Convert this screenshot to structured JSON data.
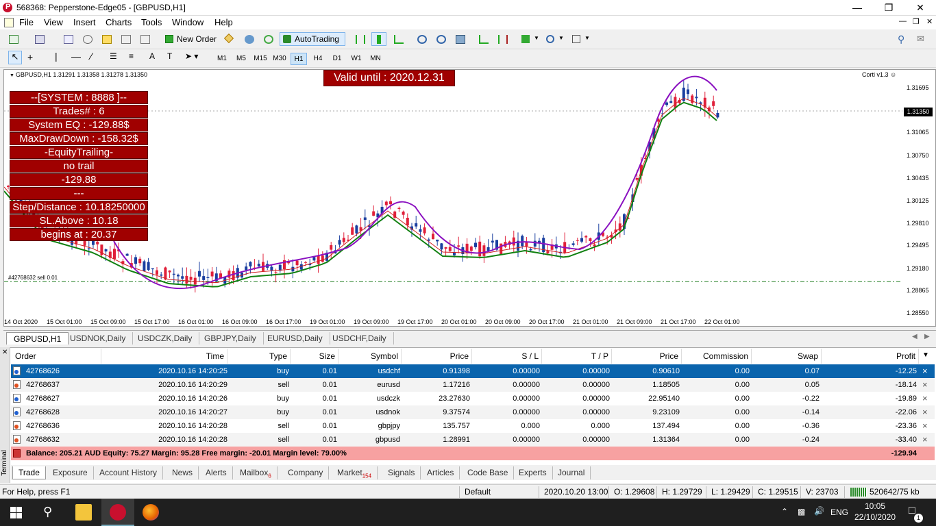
{
  "window": {
    "title": "568368: Pepperstone-Edge05 - [GBPUSD,H1]"
  },
  "menu": [
    "File",
    "View",
    "Insert",
    "Charts",
    "Tools",
    "Window",
    "Help"
  ],
  "toolbar": {
    "new_order": "New Order",
    "auto_trading": "AutoTrading"
  },
  "timeframes": [
    "M1",
    "M5",
    "M15",
    "M30",
    "H1",
    "H4",
    "D1",
    "W1",
    "MN"
  ],
  "active_timeframe": "H1",
  "chart": {
    "info": "GBPUSD,H1  1.31291 1.31358 1.31278 1.31350",
    "valid_until": "Valid until : 2020.12.31",
    "indicator": "Corti v1.3",
    "current_price": "1.31350",
    "sell_line_label": "#42768632 sell 0.01",
    "panel": [
      "--[SYSTEM : 8888 ]--",
      "Trades# : 6",
      "System EQ : -129.88$",
      "MaxDrawDown : -158.32$",
      "-EquityTrailing-",
      "no trail",
      "-129.88",
      "---",
      "Step/Distance : 10.18250000",
      "SL.Above : 10.18",
      "begins at : 20.37"
    ],
    "price_labels": [
      "1.31695",
      "1.31065",
      "1.30750",
      "1.30435",
      "1.30125",
      "1.29810",
      "1.29495",
      "1.29180",
      "1.28865",
      "1.28550"
    ],
    "time_labels": [
      "14 Oct 2020",
      "15 Oct 01:00",
      "15 Oct 09:00",
      "15 Oct 17:00",
      "16 Oct 01:00",
      "16 Oct 09:00",
      "16 Oct 17:00",
      "19 Oct 01:00",
      "19 Oct 09:00",
      "19 Oct 17:00",
      "20 Oct 01:00",
      "20 Oct 09:00",
      "20 Oct 17:00",
      "21 Oct 01:00",
      "21 Oct 09:00",
      "21 Oct 17:00",
      "22 Oct 01:00"
    ]
  },
  "chart_tabs": [
    "GBPUSD,H1",
    "USDNOK,Daily",
    "USDCZK,Daily",
    "GBPJPY,Daily",
    "EURUSD,Daily",
    "USDCHF,Daily"
  ],
  "terminal": {
    "side_label": "Terminal",
    "headers": [
      "Order",
      "Time",
      "Type",
      "Size",
      "Symbol",
      "Price",
      "S / L",
      "T / P",
      "Price",
      "Commission",
      "Swap",
      "Profit"
    ],
    "rows": [
      {
        "order": "42768626",
        "time": "2020.10.16 14:20:25",
        "type": "buy",
        "size": "0.01",
        "symbol": "usdchf",
        "price": "0.91398",
        "sl": "0.00000",
        "tp": "0.00000",
        "cur": "0.90610",
        "commission": "0.00",
        "swap": "0.07",
        "profit": "-12.25"
      },
      {
        "order": "42768637",
        "time": "2020.10.16 14:20:29",
        "type": "sell",
        "size": "0.01",
        "symbol": "eurusd",
        "price": "1.17216",
        "sl": "0.00000",
        "tp": "0.00000",
        "cur": "1.18505",
        "commission": "0.00",
        "swap": "0.05",
        "profit": "-18.14"
      },
      {
        "order": "42768627",
        "time": "2020.10.16 14:20:26",
        "type": "buy",
        "size": "0.01",
        "symbol": "usdczk",
        "price": "23.27630",
        "sl": "0.00000",
        "tp": "0.00000",
        "cur": "22.95140",
        "commission": "0.00",
        "swap": "-0.22",
        "profit": "-19.89"
      },
      {
        "order": "42768628",
        "time": "2020.10.16 14:20:27",
        "type": "buy",
        "size": "0.01",
        "symbol": "usdnok",
        "price": "9.37574",
        "sl": "0.00000",
        "tp": "0.00000",
        "cur": "9.23109",
        "commission": "0.00",
        "swap": "-0.14",
        "profit": "-22.06"
      },
      {
        "order": "42768636",
        "time": "2020.10.16 14:20:28",
        "type": "sell",
        "size": "0.01",
        "symbol": "gbpjpy",
        "price": "135.757",
        "sl": "0.000",
        "tp": "0.000",
        "cur": "137.494",
        "commission": "0.00",
        "swap": "-0.36",
        "profit": "-23.36"
      },
      {
        "order": "42768632",
        "time": "2020.10.16 14:20:28",
        "type": "sell",
        "size": "0.01",
        "symbol": "gbpusd",
        "price": "1.28991",
        "sl": "0.00000",
        "tp": "0.00000",
        "cur": "1.31364",
        "commission": "0.00",
        "swap": "-0.24",
        "profit": "-33.40"
      }
    ],
    "balance_text": "Balance: 205.21 AUD  Equity: 75.27  Margin: 95.28  Free margin: -20.01  Margin level: 79.00%",
    "total_profit": "-129.94",
    "tabs": [
      {
        "label": "Trade",
        "badge": ""
      },
      {
        "label": "Exposure",
        "badge": ""
      },
      {
        "label": "Account History",
        "badge": ""
      },
      {
        "label": "News",
        "badge": ""
      },
      {
        "label": "Alerts",
        "badge": ""
      },
      {
        "label": "Mailbox",
        "badge": "6"
      },
      {
        "label": "Company",
        "badge": ""
      },
      {
        "label": "Market",
        "badge": "154"
      },
      {
        "label": "Signals",
        "badge": ""
      },
      {
        "label": "Articles",
        "badge": ""
      },
      {
        "label": "Code Base",
        "badge": ""
      },
      {
        "label": "Experts",
        "badge": ""
      },
      {
        "label": "Journal",
        "badge": ""
      }
    ]
  },
  "status": {
    "help": "For Help, press F1",
    "profile": "Default",
    "datetime": "2020.10.20 13:00",
    "open": "O: 1.29608",
    "high": "H: 1.29729",
    "low": "L: 1.29429",
    "close": "C: 1.29515",
    "volume": "V: 23703",
    "traffic": "520642/75 kb"
  },
  "taskbar": {
    "lang": "ENG",
    "time": "10:05",
    "date": "22/10/2020",
    "notifications": "1"
  },
  "colors": {
    "panel": "#a00000",
    "selected_row": "#0a64ad",
    "balance_bar": "#f7a1a1",
    "bull_candle": "#1a3fa0",
    "bear_candle": "#e0203a"
  }
}
